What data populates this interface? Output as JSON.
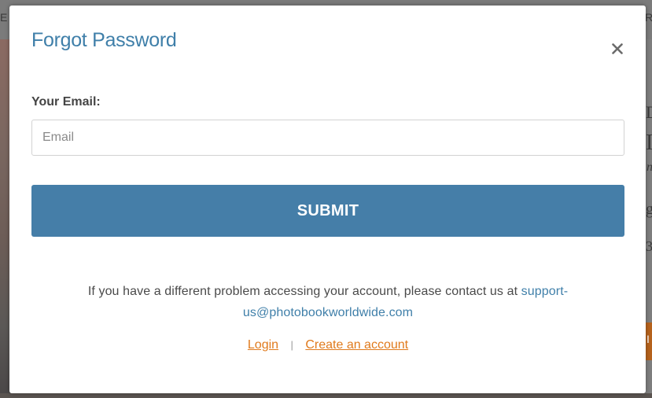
{
  "background": {
    "top_fragment_left": "E",
    "top_fragment_right": "R",
    "side_fragments": [
      "D",
      "I",
      "n",
      "g",
      "3",
      "I"
    ]
  },
  "modal": {
    "title": "Forgot Password",
    "close_icon": "close-icon",
    "email_label": "Your Email:",
    "email_placeholder": "Email",
    "email_value": "",
    "submit_label": "SUBMIT",
    "help_text_before": "If you have a different problem accessing your account, please contact us at ",
    "help_email_line1": "support-",
    "help_email_line2": "us@photobookworldwide.com",
    "login_link": "Login",
    "separator": "|",
    "create_account_link": "Create an account"
  },
  "colors": {
    "title": "#3f7fa9",
    "submit_bg": "#457ea8",
    "link_blue": "#3f7fa9",
    "link_orange": "#e07a1c"
  }
}
